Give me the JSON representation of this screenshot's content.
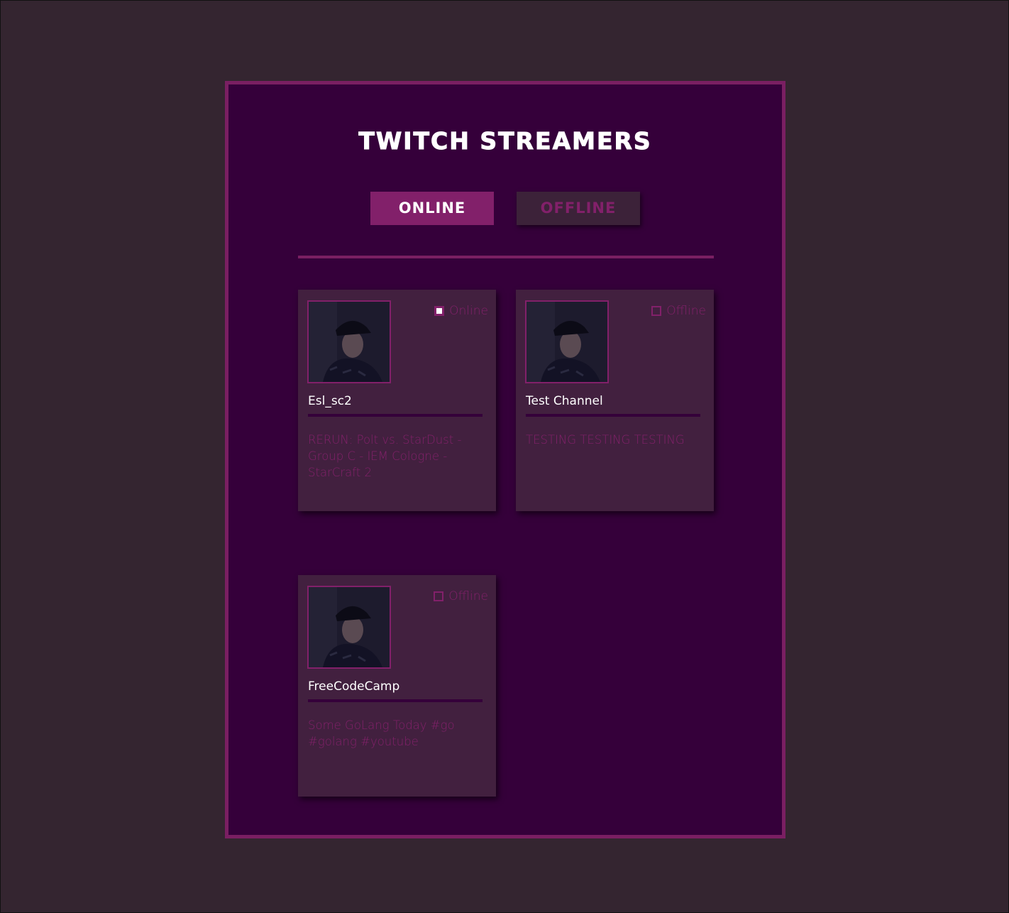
{
  "header": {
    "title": "TWITCH STREAMERS"
  },
  "filters": {
    "online_label": "ONLINE",
    "offline_label": "OFFLINE"
  },
  "colors": {
    "page_background": "#342530",
    "panel_background": "#35003a",
    "accent": "#82206a",
    "card_background": "#42203f",
    "text_primary": "#ffffff"
  },
  "streamers": [
    {
      "name": "Esl_sc2",
      "status": "Online",
      "status_checked": true,
      "description": "RERUN: Polt vs. StarDust - Group C - IEM Cologne - StarCraft 2",
      "avatar_icon": "person-with-cap-photo"
    },
    {
      "name": "Test Channel",
      "status": "Offline",
      "status_checked": false,
      "description": "TESTING TESTING TESTING",
      "avatar_icon": "person-with-cap-photo"
    },
    {
      "name": "FreeCodeCamp",
      "status": "Offline",
      "status_checked": false,
      "description": "Some GoLang Today #go #golang #youtube",
      "avatar_icon": "person-with-cap-photo"
    }
  ]
}
